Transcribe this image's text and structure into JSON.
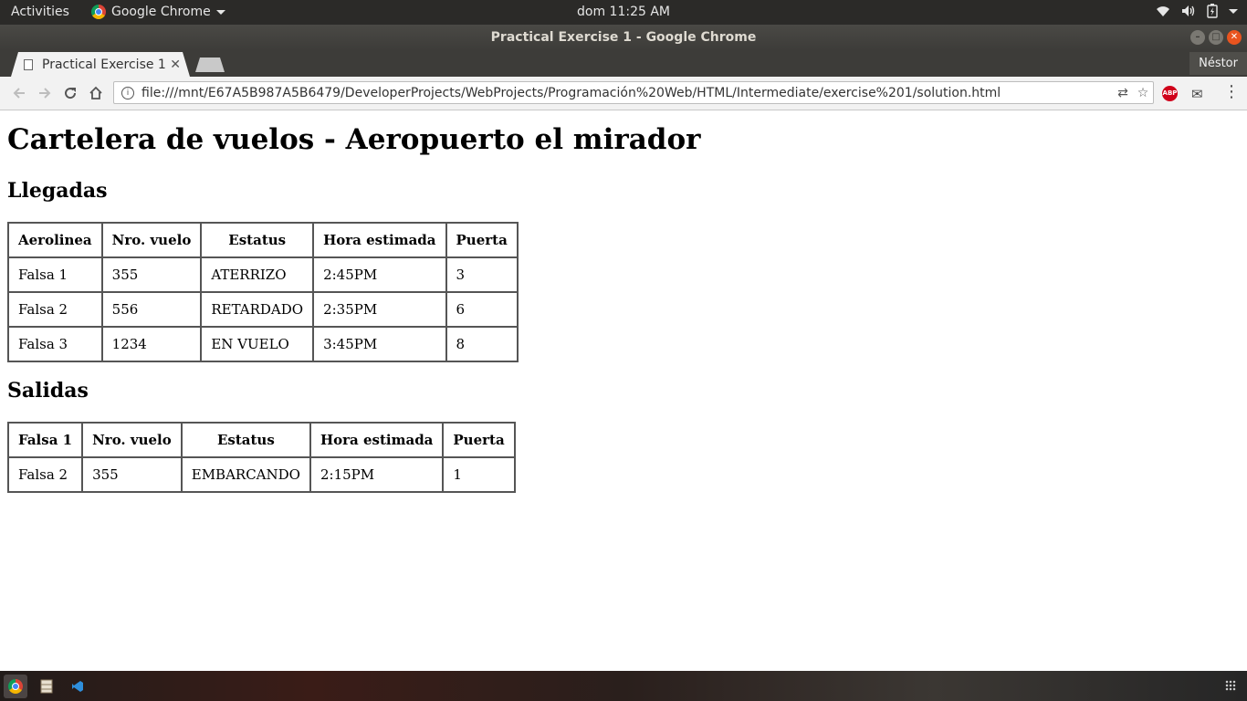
{
  "topbar": {
    "activities": "Activities",
    "app_name": "Google Chrome",
    "clock": "dom 11:25 AM"
  },
  "window": {
    "title": "Practical Exercise 1 - Google Chrome"
  },
  "tabs": [
    {
      "label": "Practical Exercise 1",
      "active": true
    }
  ],
  "profile_name": "Néstor",
  "address_bar": {
    "url": "file:///mnt/E67A5B987A5B6479/DeveloperProjects/WebProjects/Programación%20Web/HTML/Intermediate/exercise%201/solution.html"
  },
  "extensions": {
    "abp_label": "ABP"
  },
  "page": {
    "heading": "Cartelera de vuelos - Aeropuerto el mirador",
    "arrivals": {
      "title": "Llegadas",
      "headers": [
        "Aerolinea",
        "Nro. vuelo",
        "Estatus",
        "Hora estimada",
        "Puerta"
      ],
      "rows": [
        [
          "Falsa 1",
          "355",
          "ATERRIZO",
          "2:45PM",
          "3"
        ],
        [
          "Falsa 2",
          "556",
          "RETARDADO",
          "2:35PM",
          "6"
        ],
        [
          "Falsa 3",
          "1234",
          "EN VUELO",
          "3:45PM",
          "8"
        ]
      ]
    },
    "departures": {
      "title": "Salidas",
      "headers": [
        "Falsa 1",
        "Nro. vuelo",
        "Estatus",
        "Hora estimada",
        "Puerta"
      ],
      "rows": [
        [
          "Falsa 2",
          "355",
          "EMBARCANDO",
          "2:15PM",
          "1"
        ]
      ]
    }
  },
  "colors": {
    "topbar_bg": "#2b2a28",
    "titlebar_bg": "#3d3c39",
    "close_button": "#e9541f",
    "abp_red": "#d0021b"
  }
}
